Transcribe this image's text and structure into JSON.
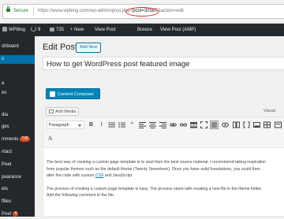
{
  "browser": {
    "secure_label": "Secure",
    "url_prefix": "https://www.wpblog.com/wp-admin/post.php?",
    "url_highlight": "post=30587",
    "url_suffix": "&action=edit"
  },
  "adminbar": {
    "site": "WPblog",
    "updates": "9",
    "comments": "735",
    "new": "+ New",
    "view_post": "View Post",
    "breeze": "Breeze",
    "view_post_amp": "View Post (AMP)"
  },
  "sidebar": {
    "items": [
      {
        "label": "shboard"
      },
      {
        "label": "s"
      },
      {
        "label": "a"
      },
      {
        "label": "es"
      },
      {
        "label": "dia"
      },
      {
        "label": "ges"
      },
      {
        "label": "mments",
        "badge": "735"
      },
      {
        "label": "ntact"
      },
      {
        "label": "Poet"
      },
      {
        "label": "pearance"
      },
      {
        "label": "ets"
      },
      {
        "label": "ffiles"
      },
      {
        "label": "Poet",
        "badge": "4"
      }
    ]
  },
  "page": {
    "title": "Edit Post",
    "add_new": "Add New",
    "post_title": "How to get WordPress post featured image",
    "composer_button": "Content Composer",
    "add_media": "Add Media",
    "visual_tab": "Visual",
    "format_select": "Paragraph"
  },
  "content": {
    "p1_line1": "The best way of creating a custom page template is to start from the best source material. I recommend taking inspiration",
    "p1_line2": "from popular themes such as the default theme (Twenty Seventeen). Once you have solid foundations, you could then",
    "p1_line3_a": "alter the code with custom ",
    "p1_line3_link": "CSS",
    "p1_line3_b": " and JavaScript.",
    "p2_line1": "The process of creating a custom page template is easy. The process starts with creating a new file in the theme folder.",
    "p2_line2": "Add the following comment to the file."
  },
  "colors": {
    "admin_bar": "#23282d",
    "primary": "#0073aa",
    "composer": "#0085ba",
    "badge": "#d54e21",
    "highlight_circle": "#d2302a"
  }
}
